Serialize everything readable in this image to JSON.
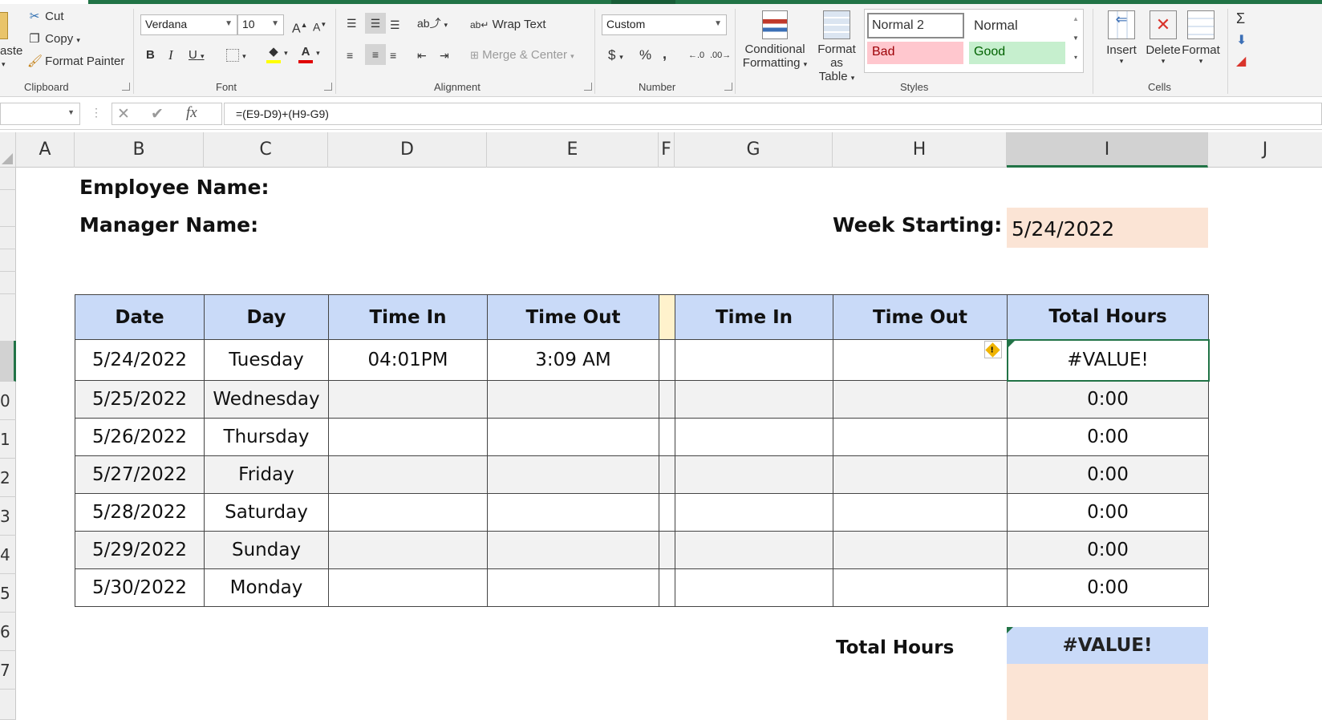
{
  "ribbon": {
    "clipboard": {
      "paste_label": "aste",
      "cut_label": "Cut",
      "copy_label": "Copy",
      "format_painter_label": "Format Painter",
      "group_label": "Clipboard"
    },
    "font": {
      "name": "Verdana",
      "size": "10",
      "bold": "B",
      "italic": "I",
      "underline": "U",
      "grow": "A",
      "shrink": "A",
      "font_color_icon": "A",
      "group_label": "Font"
    },
    "alignment": {
      "wrap_text_label": "Wrap Text",
      "merge_center_label": "Merge & Center",
      "group_label": "Alignment"
    },
    "number": {
      "format": "Custom",
      "currency": "$",
      "percent": "%",
      "comma": ",",
      "group_label": "Number"
    },
    "styles": {
      "conditional_formatting": [
        "Conditional",
        "Formatting"
      ],
      "format_as_table": [
        "Format as",
        "Table"
      ],
      "normal2": "Normal 2",
      "normal": "Normal",
      "bad": "Bad",
      "good": "Good",
      "group_label": "Styles",
      "colors": {
        "bad_bg": "#ffc7ce",
        "bad_fg": "#9c0006",
        "good_bg": "#c6efce",
        "good_fg": "#006100"
      }
    },
    "cells": {
      "insert_label": "Insert",
      "delete_label": "Delete",
      "format_label": "Format",
      "group_label": "Cells"
    },
    "editing": {
      "sum_icon": "Σ"
    }
  },
  "formula_bar": {
    "formula": "=(E9-D9)+(H9-G9)",
    "cancel": "✕",
    "enter": "✔",
    "fx": "fx"
  },
  "columns": [
    "A",
    "B",
    "C",
    "D",
    "E",
    "F",
    "G",
    "H",
    "I",
    "J"
  ],
  "rows": [
    "",
    "",
    "",
    "",
    "",
    "",
    "0",
    "1",
    "2",
    "3",
    "4",
    "5",
    "6",
    "7"
  ],
  "sheet": {
    "employee_label": "Employee Name:",
    "manager_label": "Manager Name:",
    "week_label": "Week Starting:",
    "week_value": "5/24/2022",
    "headers": [
      "Date",
      "Day",
      "Time In",
      "Time Out",
      "Time In",
      "Time Out",
      "Total Hours"
    ],
    "rows": [
      {
        "date": "5/24/2022",
        "day": "Tuesday",
        "in1": "04:01PM",
        "out1": "3:09 AM",
        "in2": "",
        "out2": "",
        "total": "#VALUE!"
      },
      {
        "date": "5/25/2022",
        "day": "Wednesday",
        "in1": "",
        "out1": "",
        "in2": "",
        "out2": "",
        "total": "0:00"
      },
      {
        "date": "5/26/2022",
        "day": "Thursday",
        "in1": "",
        "out1": "",
        "in2": "",
        "out2": "",
        "total": "0:00"
      },
      {
        "date": "5/27/2022",
        "day": "Friday",
        "in1": "",
        "out1": "",
        "in2": "",
        "out2": "",
        "total": "0:00"
      },
      {
        "date": "5/28/2022",
        "day": "Saturday",
        "in1": "",
        "out1": "",
        "in2": "",
        "out2": "",
        "total": "0:00"
      },
      {
        "date": "5/29/2022",
        "day": "Sunday",
        "in1": "",
        "out1": "",
        "in2": "",
        "out2": "",
        "total": "0:00"
      },
      {
        "date": "5/30/2022",
        "day": "Monday",
        "in1": "",
        "out1": "",
        "in2": "",
        "out2": "",
        "total": "0:00"
      }
    ],
    "total_label": "Total Hours",
    "total_value": "#VALUE!",
    "error_icon": "!"
  },
  "colors": {
    "accent": "#217346",
    "header_fill": "#c9daf8",
    "date_fill": "#fbe4d5",
    "gap_fill": "#fff2cc"
  }
}
